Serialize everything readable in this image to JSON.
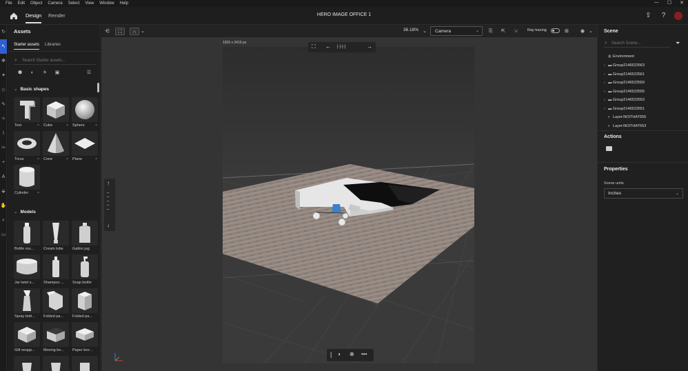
{
  "menu": [
    "File",
    "Edit",
    "Object",
    "Camera",
    "Select",
    "View",
    "Window",
    "Help"
  ],
  "window_controls": [
    "—",
    "☐",
    "✕"
  ],
  "tabs": [
    "Design",
    "Render"
  ],
  "document_title": "HERO IMAGE OFFICE 1",
  "assets": {
    "title": "Assets",
    "subtabs": [
      "Starter assets",
      "Libraries"
    ],
    "search_placeholder": "Search Starter assets...",
    "sections": {
      "basic_shapes": "Basic shapes",
      "models": "Models"
    },
    "basic_shapes": [
      "Text",
      "Cube",
      "Sphere",
      "Torus",
      "Cone",
      "Plane",
      "Cylinder"
    ],
    "models": [
      "Bottle rou...",
      "Cream tube",
      "Gallon jug",
      "Jar twist s...",
      "Shampoo ...",
      "Soap bottle",
      "Spray bott...",
      "Folded pa...",
      "Folded pa...",
      "Gift wrapp...",
      "Moving bo...",
      "Paper box ..."
    ]
  },
  "viewport_toolbar": {
    "zoom": "36.18%",
    "camera": "Camera",
    "ray_tracing": "Ray tracing",
    "ray_tracing_on": false
  },
  "canvas": {
    "dimensions": "1920 x 2416 px"
  },
  "scene": {
    "title": "Scene",
    "search_placeholder": "Search Scene...",
    "items": [
      {
        "label": "Environment",
        "kind": "env"
      },
      {
        "label": "Group2146523563",
        "kind": "group"
      },
      {
        "label": "Group2146523561",
        "kind": "group"
      },
      {
        "label": "Group2146523559",
        "kind": "group"
      },
      {
        "label": "Group2146523555",
        "kind": "group"
      },
      {
        "label": "Group2146523553",
        "kind": "group"
      },
      {
        "label": "Group2146523551",
        "kind": "group"
      },
      {
        "label": "Layer:NOITHAT655",
        "kind": "layer"
      },
      {
        "label": "Layer:NOITHAT653",
        "kind": "layer"
      }
    ]
  },
  "actions": {
    "title": "Actions"
  },
  "properties": {
    "title": "Properties",
    "scene_units_label": "Scene units",
    "scene_units_value": "Inches"
  },
  "colors": {
    "accent": "#2f5fd0",
    "user_avatar": "#8b1e1e"
  }
}
